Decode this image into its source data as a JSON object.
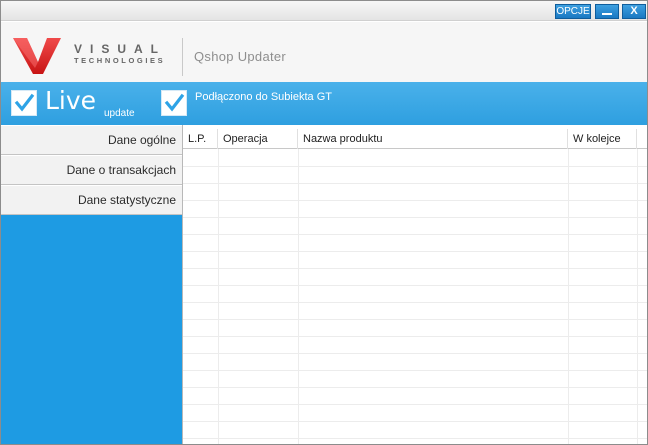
{
  "titlebar": {
    "options_label": "OPCJE",
    "minimize_label": "",
    "close_label": "X"
  },
  "header": {
    "logo_main": "VISUAL",
    "logo_sub": "TECHNOLOGIES",
    "app_title": "Qshop Updater"
  },
  "status": {
    "live_label": "Live",
    "update_label": "update",
    "connection_label": "Podłączono do Subiekta GT",
    "accent_color": "#2ea3e6"
  },
  "sidebar": {
    "items": [
      {
        "label": "Dane ogólne"
      },
      {
        "label": "Dane o transakcjach"
      },
      {
        "label": "Dane statystyczne"
      }
    ]
  },
  "table": {
    "columns": [
      "L.P.",
      "Operacja",
      "Nazwa produktu",
      "W kolejce"
    ],
    "rows": []
  }
}
